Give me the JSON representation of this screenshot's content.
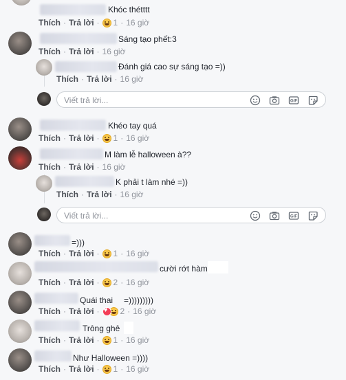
{
  "actions": {
    "like": "Thích",
    "reply": "Trả lời",
    "sep": "·"
  },
  "reply_placeholder": "Viết trả lời...",
  "comments": [
    {
      "text": "Khóc thétttt",
      "reactions": "1",
      "time": "16 giờ"
    },
    {
      "text": "Sáng tạo phết:3",
      "time": "16 giờ"
    },
    {
      "text": "Đánh giá cao sự sáng tạo =))",
      "time": "16 giờ"
    },
    {
      "text": "Khéo tay quá",
      "reactions": "1",
      "time": "16 giờ"
    },
    {
      "text": "M làm lễ halloween à??",
      "time": "16 giờ"
    },
    {
      "text": "K phải t làm nhé =))",
      "time": "16 giờ"
    },
    {
      "text": "=)))",
      "reactions": "1",
      "time": "16 giờ"
    },
    {
      "text": "cười rớt hàm",
      "reactions": "2",
      "time": "16 giờ"
    },
    {
      "text": "Quái thai",
      "text2": "=)))))))))",
      "reactions": "2",
      "time": "16 giờ"
    },
    {
      "text": "Trông ghê",
      "reactions": "1",
      "time": "16 giờ"
    },
    {
      "text": "Như Halloween =))))",
      "reactions": "1",
      "time": "16 giờ"
    }
  ],
  "colors": {
    "link": "#4b4f56",
    "meta": "#90949c",
    "bg": "#f6f7f9"
  }
}
